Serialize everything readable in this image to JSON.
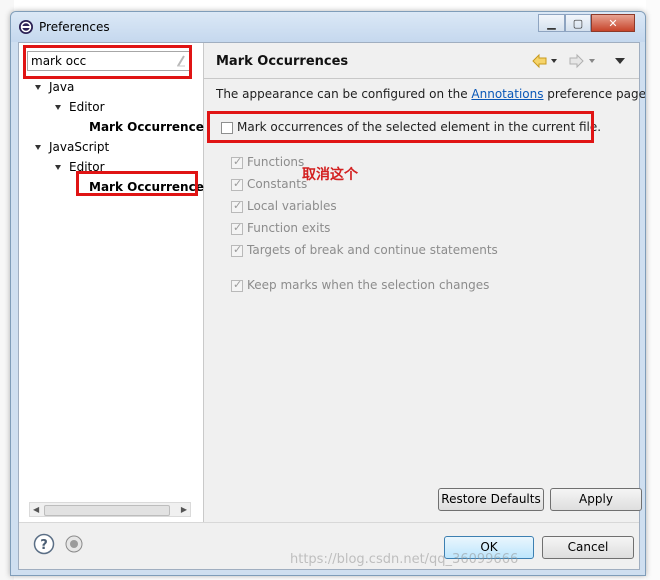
{
  "window": {
    "title": "Preferences"
  },
  "filter": {
    "value": "mark occ"
  },
  "tree": {
    "java": "Java",
    "java_editor": "Editor",
    "java_mark": "Mark Occurrence",
    "js": "JavaScript",
    "js_editor": "Editor",
    "js_mark": "Mark Occurrence"
  },
  "page": {
    "title": "Mark Occurrences",
    "desc_prefix": "The appearance can be configured on the ",
    "desc_link": "Annotations",
    "desc_suffix": " preference page.",
    "main_option": "Mark occurrences of the selected element in the current file.",
    "annotation": "取消这个",
    "options": [
      "Functions",
      "Constants",
      "Local variables",
      "Function exits",
      "Targets of break and continue statements",
      "Keep marks when the selection changes"
    ]
  },
  "buttons": {
    "restore": "Restore Defaults",
    "apply": "Apply",
    "ok": "OK",
    "cancel": "Cancel"
  },
  "watermark": "https://blog.csdn.net/qq_36099666",
  "colors": {
    "highlight": "#e01414",
    "link": "#0a58b8"
  }
}
